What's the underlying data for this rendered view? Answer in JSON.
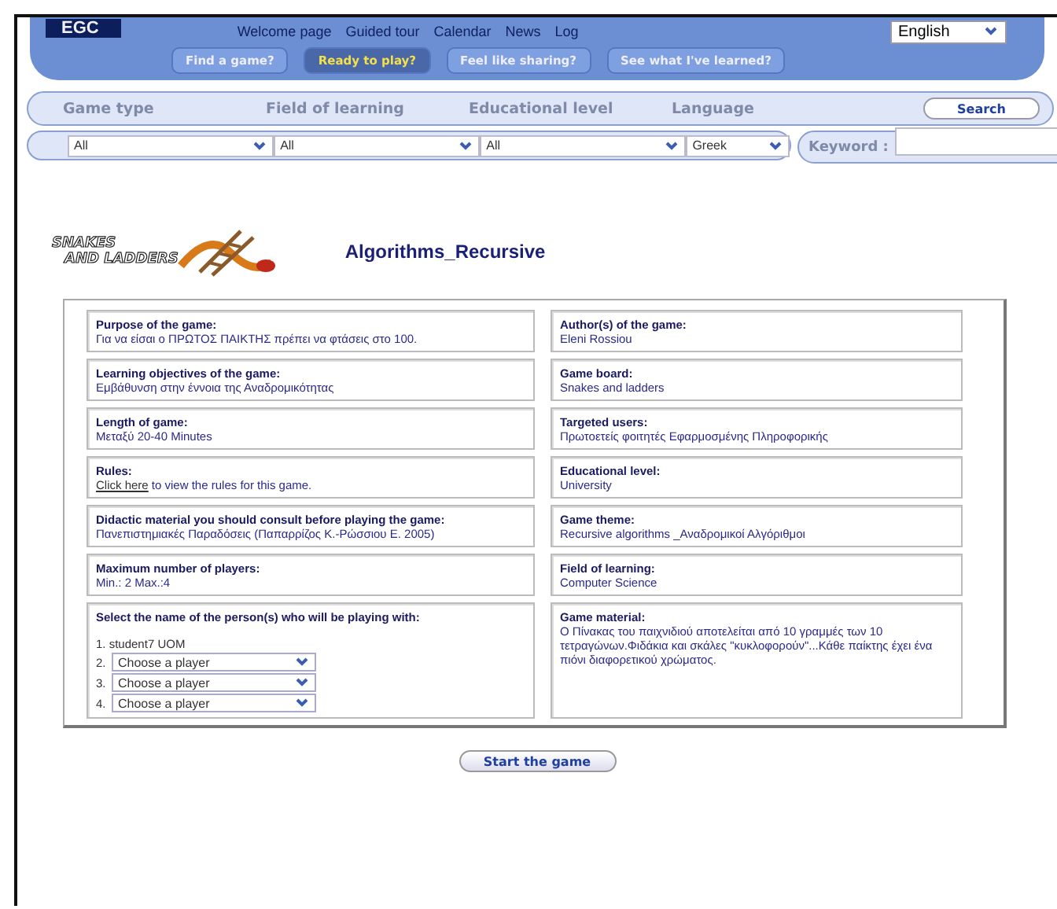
{
  "header": {
    "logo": "EGC",
    "nav": [
      "Welcome page",
      "Guided tour",
      "Calendar",
      "News",
      "Log"
    ],
    "language": "English",
    "tabs": [
      {
        "label": "Find a game?",
        "selected": false
      },
      {
        "label": "Ready to play?",
        "selected": true
      },
      {
        "label": "Feel like sharing?",
        "selected": false
      },
      {
        "label": "See what I've learned?",
        "selected": false
      }
    ]
  },
  "filters": {
    "labels": [
      "Game type",
      "Field of learning",
      "Educational level",
      "Language"
    ],
    "search": "Search",
    "selects": [
      "All",
      "All",
      "All",
      "Greek"
    ],
    "keyword_label": "Keyword :"
  },
  "game": {
    "logo": [
      "SNAKES",
      "AND LADDERS"
    ],
    "title": "Algorithms_Recursive"
  },
  "rows": [
    {
      "left": {
        "kind": "text",
        "label": "Purpose of the game:",
        "value": "Για να είσαι ο ΠΡΩΤΟΣ ΠΑΙΚΤΗΣ πρέπει να φτάσεις στο 100."
      },
      "right": {
        "kind": "text",
        "label": "Author(s) of the game:",
        "value": "Eleni Rossiou"
      }
    },
    {
      "left": {
        "kind": "text",
        "label": "Learning objectives of the game:",
        "value": "Εμβάθυνση στην έννοια της Αναδρομικότητας"
      },
      "right": {
        "kind": "text",
        "label": "Game board:",
        "value": "Snakes and ladders"
      }
    },
    {
      "left": {
        "kind": "text",
        "label": "Length of game:",
        "value": "Μεταξύ 20-40 Minutes"
      },
      "right": {
        "kind": "text",
        "label": "Targeted users:",
        "value": "Πρωτοετείς φοιτητές Εφαρμοσμένης Πληροφορικής"
      }
    },
    {
      "left": {
        "kind": "link",
        "label": "Rules:",
        "link": "Click here",
        "value": "to view the rules for this game."
      },
      "right": {
        "kind": "text",
        "label": "Educational level:",
        "value": "University"
      }
    },
    {
      "left": {
        "kind": "text",
        "label": "Didactic material you should consult before playing the game:",
        "value": "Πανεπιστημιακές Παραδόσεις (Παπαρρίζος Κ.-Ρώσσιου Ε. 2005)"
      },
      "right": {
        "kind": "text",
        "label": "Game theme:",
        "value": "Recursive algorithms _Αναδρομικοί Αλγόριθμοι"
      }
    },
    {
      "left": {
        "kind": "text",
        "label": "Maximum number of players:",
        "value": "Min.:  2   Max.:4"
      },
      "right": {
        "kind": "text",
        "label": "Field of learning:",
        "value": "Computer Science"
      }
    },
    {
      "left": {
        "kind": "players",
        "label": "Select the name of the person(s) who will be playing with:",
        "first": "1. student7 UOM",
        "players": [
          {
            "number": "2.",
            "value": "Choose a player"
          },
          {
            "number": "3.",
            "value": "Choose a player"
          },
          {
            "number": "4.",
            "value": "Choose a player"
          }
        ]
      },
      "right": {
        "kind": "text",
        "label": "Game material:",
        "value": "Ο Πίνακας του παιχνιδιού αποτελείται από 10 γραμμές των 10 τετραγώνων.Φιδάκια και σκάλες \"κυκλοφορούν\"...Κάθε παίκτης έχει ένα πιόνι διαφορετικού χρώματος."
      }
    }
  ],
  "start": "Start the game"
}
